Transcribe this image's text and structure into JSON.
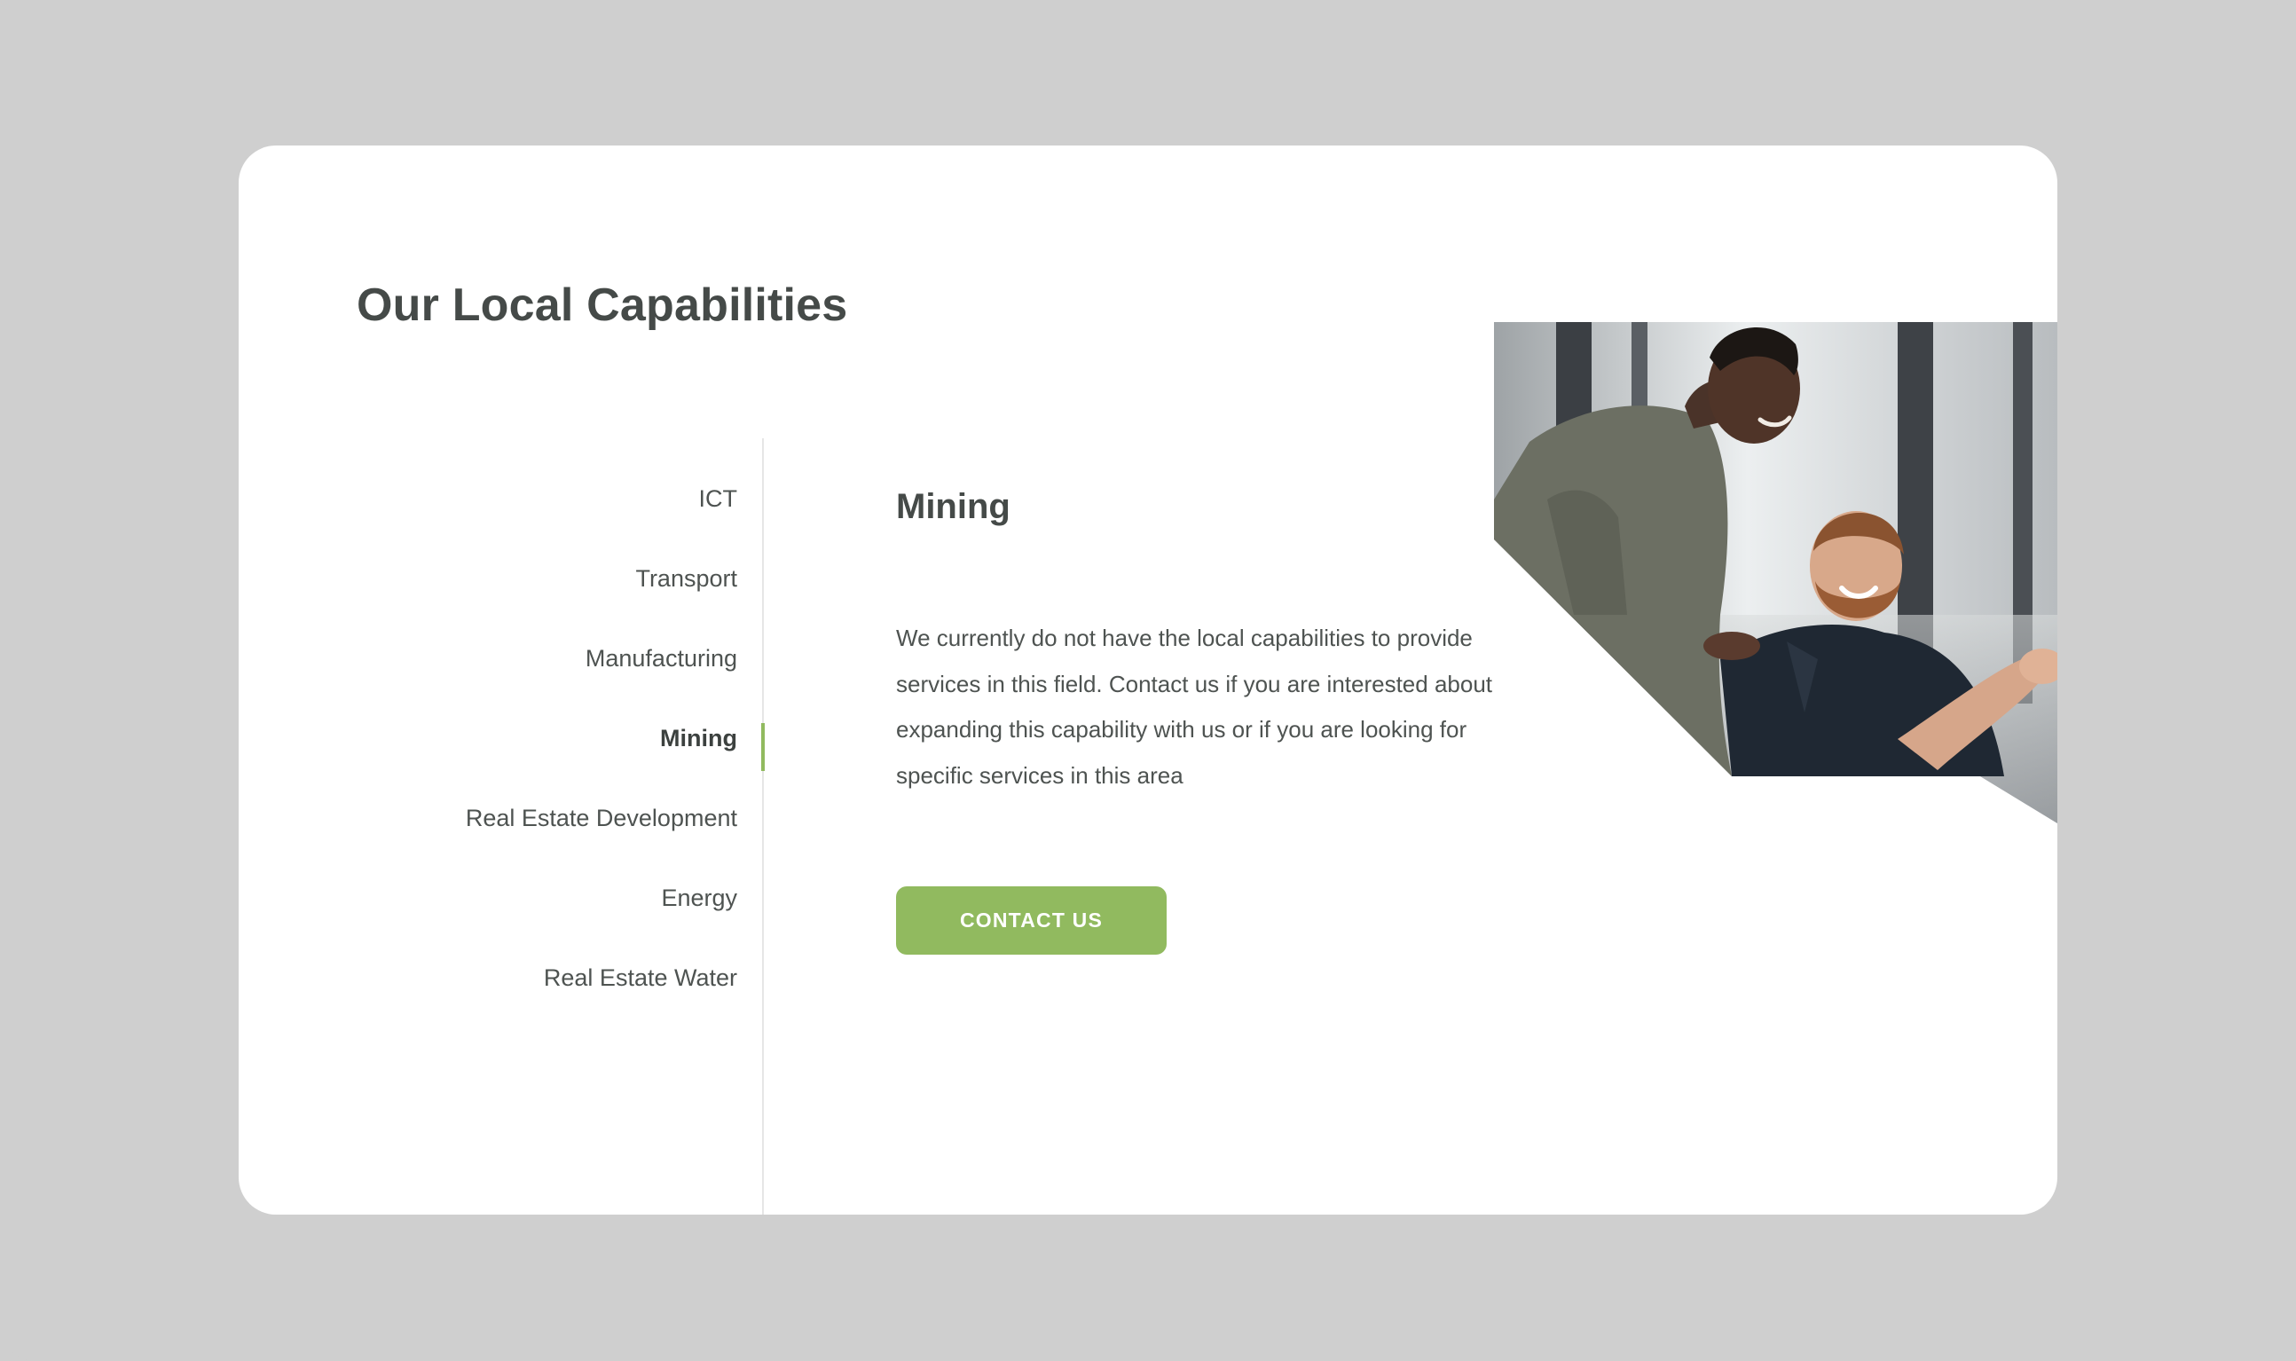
{
  "header": {
    "title": "Our Local Capabilities"
  },
  "nav": {
    "items": [
      {
        "label": "ICT",
        "active": false
      },
      {
        "label": "Transport",
        "active": false
      },
      {
        "label": "Manufacturing",
        "active": false
      },
      {
        "label": "Mining",
        "active": true
      },
      {
        "label": "Real Estate Development",
        "active": false
      },
      {
        "label": "Energy",
        "active": false
      },
      {
        "label": "Real Estate Water",
        "active": false
      }
    ]
  },
  "content": {
    "title": "Mining",
    "body": "We currently do not have the local capabilities to provide services in this field. Contact us if you are interested about expanding this capability with us or if you are looking for specific services in this area",
    "cta_label": "CONTACT US"
  },
  "image": {
    "subject": "two-men-smiling-photo"
  },
  "colors": {
    "accent": "#91ba5f",
    "text": "#454a48",
    "background": "#cfcfcf",
    "card": "#ffffff"
  }
}
